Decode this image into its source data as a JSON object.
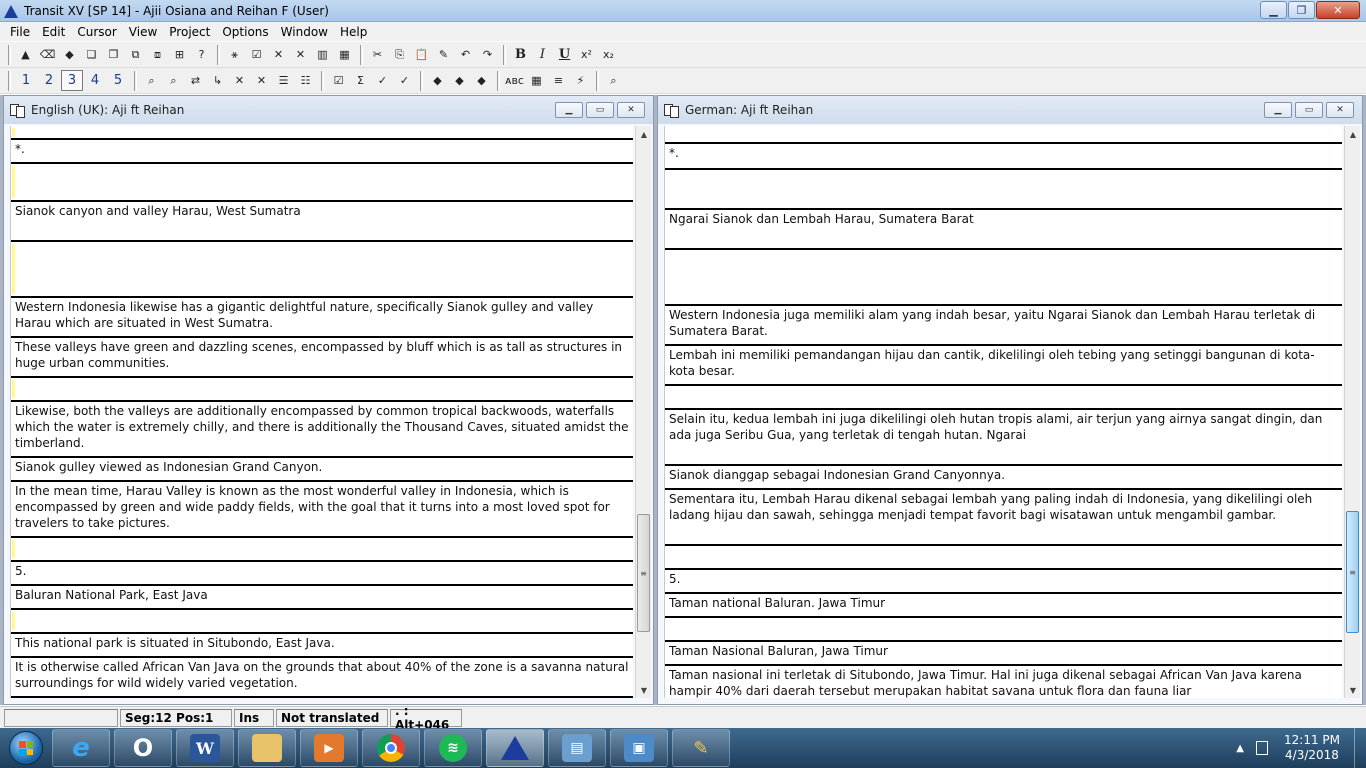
{
  "window": {
    "title": "Transit XV [SP 14] - Ajii Osiana and Reihan F (User)"
  },
  "menu": [
    "File",
    "Edit",
    "Cursor",
    "View",
    "Project",
    "Options",
    "Window",
    "Help"
  ],
  "toolbar2_numbers": [
    "1",
    "2",
    "3",
    "4",
    "5"
  ],
  "format_buttons": {
    "bold": "B",
    "italic": "I",
    "underline": "U"
  },
  "panes": {
    "source": {
      "title": "English (UK): Aji ft Reihan",
      "segments": [
        {
          "text": "",
          "h": 14,
          "mark": true
        },
        {
          "text": "*.",
          "h": 24,
          "mark": false
        },
        {
          "text": "",
          "h": 38,
          "mark": true
        },
        {
          "text": "Sianok canyon and valley Harau, West Sumatra",
          "h": 40,
          "mark": false
        },
        {
          "text": "",
          "h": 56,
          "mark": true
        },
        {
          "text": "Western Indonesia likewise has a gigantic delightful nature, specifically Sianok gulley and valley Harau which are situated in West Sumatra.",
          "h": 40,
          "mark": false
        },
        {
          "text": "These valleys have green and dazzling scenes, encompassed by bluff which is as tall as structures in huge urban communities.",
          "h": 40,
          "mark": false
        },
        {
          "text": "",
          "h": 24,
          "mark": true
        },
        {
          "text": "Likewise, both the valleys are additionally encompassed by common tropical backwoods, waterfalls which the water is extremely chilly, and there is additionally the Thousand Caves, situated amidst the timberland.",
          "h": 56,
          "mark": false
        },
        {
          "text": "Sianok gulley viewed as Indonesian Grand Canyon.",
          "h": 24,
          "mark": false
        },
        {
          "text": "In the mean time, Harau Valley is known as the most wonderful valley in Indonesia, which is encompassed by green and wide paddy fields, with the goal that it turns into a most loved spot for travelers to take pictures.",
          "h": 56,
          "mark": false
        },
        {
          "text": "",
          "h": 24,
          "mark": true
        },
        {
          "text": " 5.",
          "h": 24,
          "mark": false
        },
        {
          "text": "Baluran National Park, East Java",
          "h": 24,
          "mark": false
        },
        {
          "text": "",
          "h": 24,
          "mark": true
        },
        {
          "text": "This national park is situated in Situbondo, East Java.",
          "h": 24,
          "mark": false
        },
        {
          "text": "It is otherwise called African Van Java on the grounds that about 40% of the zone is a savanna natural surroundings for wild widely varied vegetation.",
          "h": 40,
          "mark": false
        }
      ]
    },
    "target": {
      "title": "German: Aji ft Reihan",
      "segments": [
        {
          "text": "",
          "h": 18,
          "mark": false
        },
        {
          "text": "*.",
          "h": 26,
          "mark": false
        },
        {
          "text": "",
          "h": 40,
          "mark": false
        },
        {
          "text": "Ngarai Sianok dan Lembah Harau, Sumatera Barat",
          "h": 40,
          "mark": false
        },
        {
          "text": "",
          "h": 56,
          "mark": false
        },
        {
          "text": "Western Indonesia juga memiliki alam yang indah besar, yaitu Ngarai Sianok dan Lembah Harau terletak di Sumatera Barat.",
          "h": 40,
          "mark": false
        },
        {
          "text": "Lembah ini memiliki pemandangan hijau dan cantik, dikelilingi oleh tebing yang setinggi bangunan di kota-kota besar.",
          "h": 40,
          "mark": false
        },
        {
          "text": "",
          "h": 24,
          "mark": false
        },
        {
          "text": "Selain itu, kedua lembah ini juga dikelilingi oleh hutan tropis alami, air terjun yang airnya sangat dingin, dan ada juga Seribu Gua, yang terletak di tengah hutan. Ngarai",
          "h": 56,
          "mark": false
        },
        {
          "text": "Sianok dianggap sebagai Indonesian Grand Canyonnya.",
          "h": 24,
          "mark": false
        },
        {
          "text": "Sementara itu, Lembah Harau dikenal sebagai lembah yang paling indah di Indonesia, yang dikelilingi oleh ladang hijau dan sawah, sehingga menjadi tempat favorit bagi wisatawan untuk mengambil gambar.",
          "h": 56,
          "mark": false
        },
        {
          "text": "",
          "h": 24,
          "mark": false
        },
        {
          "text": " 5.",
          "h": 24,
          "mark": false
        },
        {
          "text": "Taman national Baluran. Jawa Timur",
          "h": 24,
          "mark": false
        },
        {
          "text": "",
          "h": 24,
          "mark": false
        },
        {
          "text": "Taman Nasional Baluran, Jawa Timur",
          "h": 24,
          "mark": false
        },
        {
          "text": "Taman nasional ini terletak di Situbondo, Jawa Timur. Hal ini juga dikenal sebagai African Van Java karena hampir 40% dari daerah tersebut merupakan habitat savana untuk flora dan fauna liar",
          "h": 40,
          "mark": false
        }
      ]
    }
  },
  "status": {
    "seg_pos": "Seg:12 Pos:1",
    "mode": "Ins",
    "state": "Not translated",
    "shortcut": ". : Alt+046"
  },
  "clock": {
    "time": "12:11 PM",
    "date": "4/3/2018"
  },
  "colors": {
    "accent": "#1d3d9c",
    "segment_marker": "#fffb8f",
    "taskbar": "#2a4d6e"
  }
}
